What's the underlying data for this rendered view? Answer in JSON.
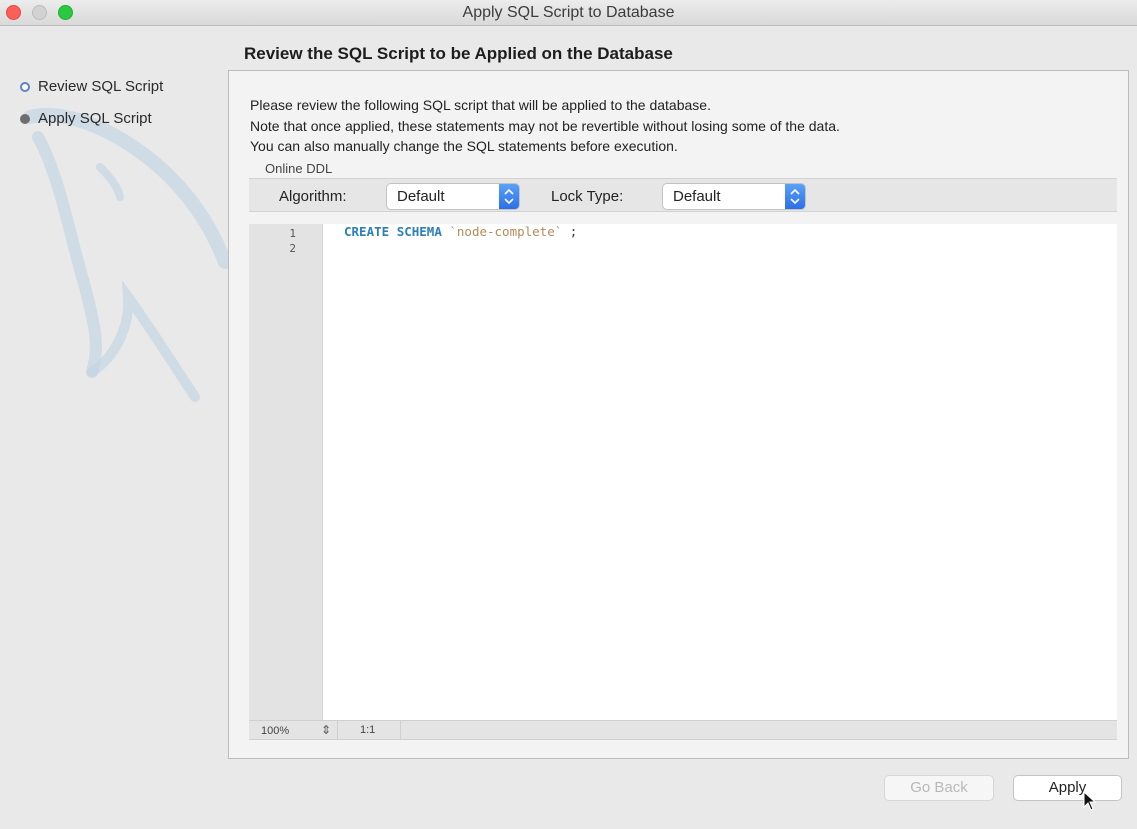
{
  "window": {
    "title": "Apply SQL Script to Database"
  },
  "sidebar": {
    "steps": [
      {
        "label": "Review SQL Script",
        "state": "active"
      },
      {
        "label": "Apply SQL Script",
        "state": "pending"
      }
    ]
  },
  "header": {
    "title": "Review the SQL Script to be Applied on the Database"
  },
  "description": {
    "line1": "Please review the following SQL script that will be applied to the database.",
    "line2": "Note that once applied, these statements may not be revertible without losing some of the data.",
    "line3": "You can also manually change the SQL statements before execution."
  },
  "online_ddl": {
    "label": "Online DDL",
    "algorithm_label": "Algorithm:",
    "algorithm_value": "Default",
    "lock_type_label": "Lock Type:",
    "lock_type_value": "Default"
  },
  "editor": {
    "line_numbers": [
      "1",
      "2"
    ],
    "code": {
      "keyword1": "CREATE",
      "keyword2": "SCHEMA",
      "identifier": "`node-complete`",
      "terminator": ";"
    },
    "status": {
      "zoom": "100%",
      "cursor": "1:1"
    }
  },
  "buttons": {
    "go_back": "Go Back",
    "apply": "Apply"
  },
  "colors": {
    "keyword": "#2c80b9",
    "string": "#b58a5a",
    "accent": "#2c6fe6"
  }
}
